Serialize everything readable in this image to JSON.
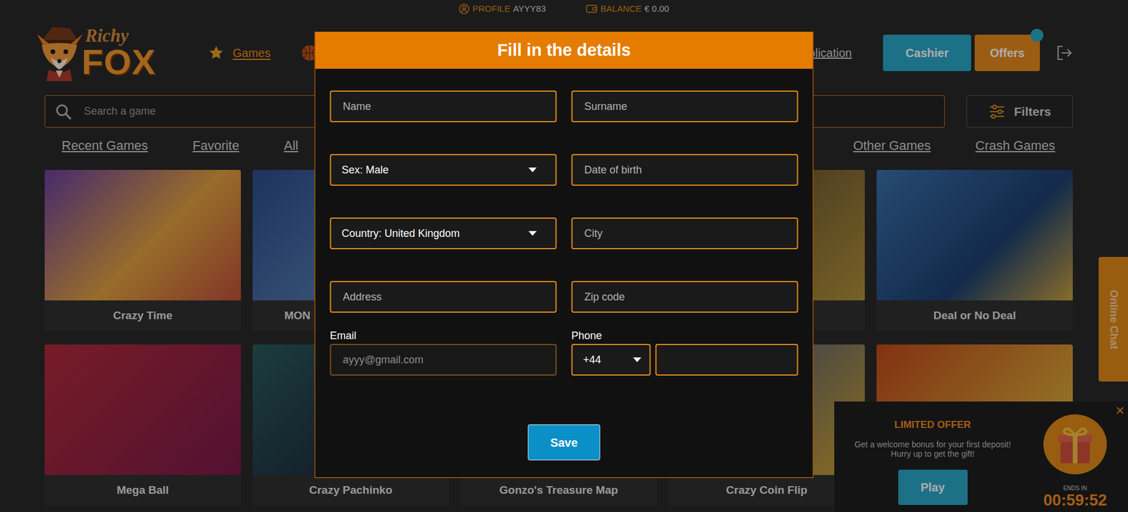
{
  "account": {
    "profile": {
      "label": "PROFILE",
      "value": "AYYY83"
    },
    "balance": {
      "label": "BALANCE",
      "value": "€ 0.00"
    }
  },
  "logo": {
    "top": "Richy",
    "bottom": "FOX"
  },
  "nav": [
    {
      "label": "Games",
      "selected": true
    }
  ],
  "partial_link": "plication",
  "header_buttons": {
    "cashier": "Cashier",
    "offers": "Offers"
  },
  "search": {
    "placeholder": "Search a game"
  },
  "filters": "Filters",
  "categories_start": [
    {
      "label": "Recent Games",
      "selected": false
    },
    {
      "label": "Favorite",
      "selected": false
    },
    {
      "label": "All",
      "selected": false
    }
  ],
  "categories_end": [
    {
      "label": "Other Games",
      "selected": false
    },
    {
      "label": "Crash Games",
      "selected": false
    }
  ],
  "games": [
    {
      "title": "Crazy Time"
    },
    {
      "title": "MON"
    },
    {},
    {},
    {
      "title": "Deal or No Deal"
    },
    {
      "title": "Mega Ball"
    },
    {
      "title": "Crazy Pachinko"
    },
    {
      "title": "Gonzo's Treasure Map"
    },
    {
      "title": "Crazy Coin Flip"
    },
    {}
  ],
  "online_chat": "Online Chat",
  "offer": {
    "title": "LIMITED OFFER",
    "text": [
      "Get a welcome bonus for your first deposit!",
      "Hurry up to get the gift!"
    ],
    "button": "Play",
    "ends_label": "ENDS IN",
    "countdown": "00:59:52",
    "close": "×"
  },
  "dialog": {
    "title": "Fill in the details",
    "fields": [
      {
        "kind": "text",
        "placeholder": "Name"
      },
      {
        "kind": "text",
        "placeholder": "Surname"
      },
      {
        "kind": "select",
        "value": "Sex: Male"
      },
      {
        "kind": "text",
        "placeholder": "Date of birth"
      },
      {
        "kind": "select",
        "value": "Country: United Kingdom"
      },
      {
        "kind": "text",
        "placeholder": "City"
      },
      {
        "kind": "text",
        "placeholder": "Address"
      },
      {
        "kind": "text",
        "placeholder": "Zip code"
      }
    ],
    "email": {
      "label": "Email",
      "value": "ayyy@gmail.com",
      "disabled": true
    },
    "phone": {
      "label": "Phone",
      "code": "+44"
    },
    "save": "Save"
  }
}
